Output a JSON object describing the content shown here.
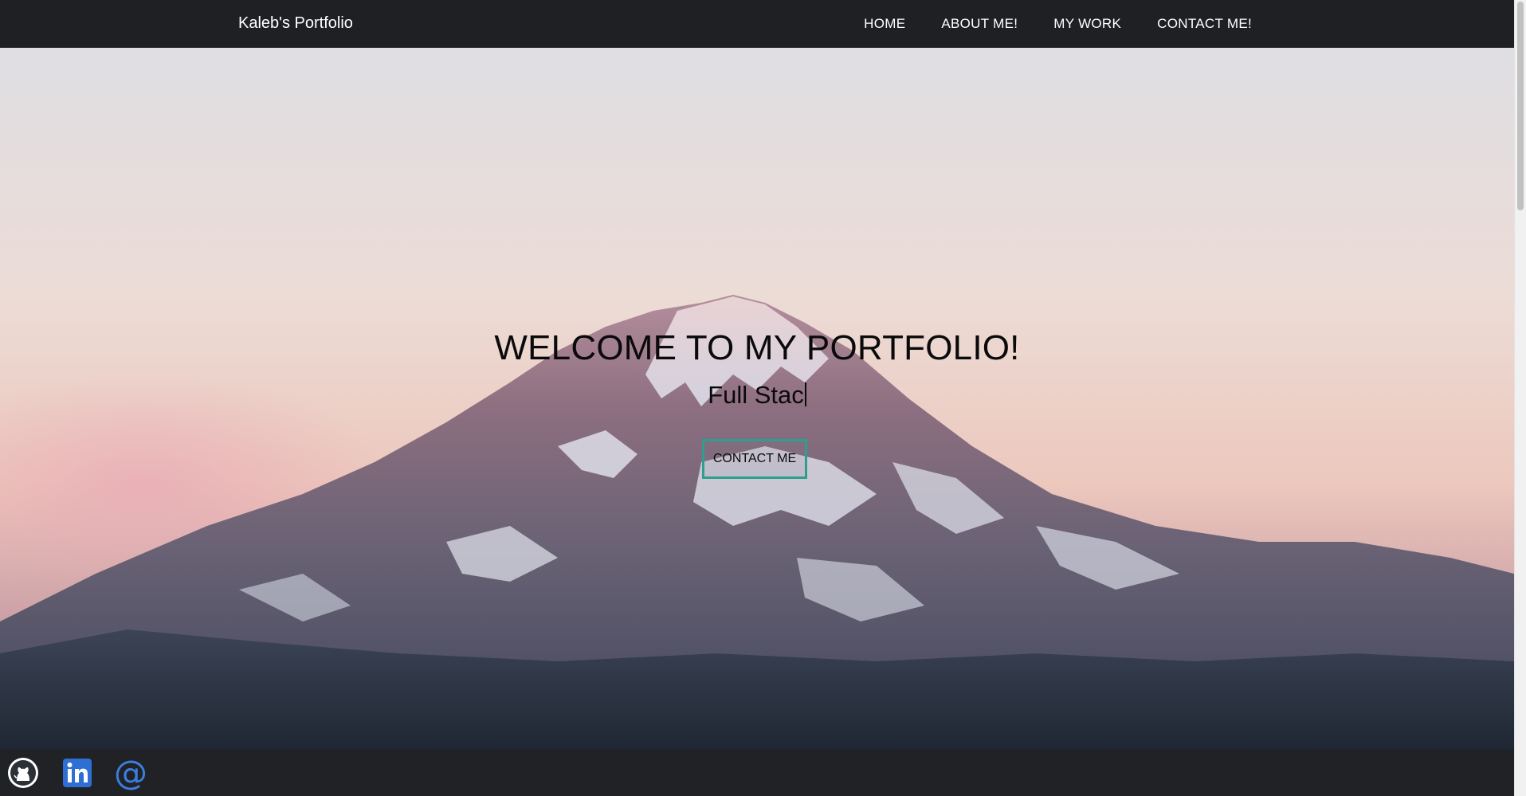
{
  "navbar": {
    "brand": "Kaleb's Portfolio",
    "links": [
      {
        "label": "HOME"
      },
      {
        "label": "ABOUT ME!"
      },
      {
        "label": "MY WORK"
      },
      {
        "label": "CONTACT ME!"
      }
    ]
  },
  "hero": {
    "title": "WELCOME TO MY PORTFOLIO!",
    "subtitle_typed": "Full Stac",
    "cta_label": "CONTACT ME"
  },
  "footer": {
    "social": [
      {
        "icon": "github-icon"
      },
      {
        "icon": "linkedin-icon"
      },
      {
        "icon": "email-at-icon",
        "glyph": "@"
      }
    ]
  },
  "colors": {
    "navbar_bg": "#1f2024",
    "footer_bg": "#212226",
    "cta_border": "#2e9e8f",
    "linkedin_blue": "#2e6fd3",
    "email_blue": "#3a7fe0"
  }
}
